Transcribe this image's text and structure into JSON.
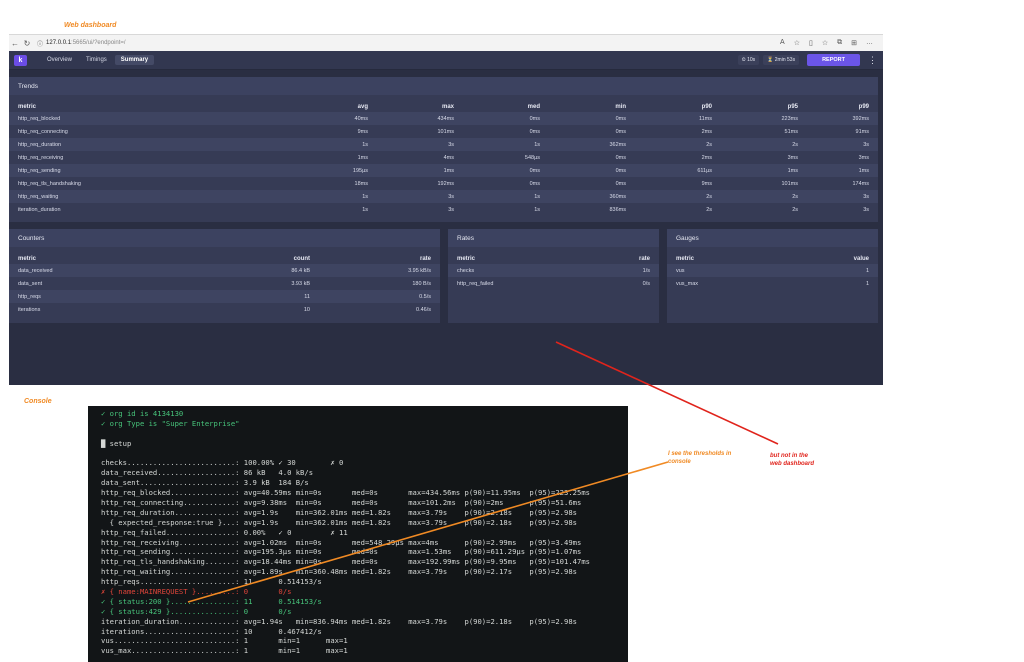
{
  "annotations": {
    "dashboard_title": "Web dashboard",
    "console_title": "Console",
    "note_orange": [
      "I see the thresholds in",
      "console"
    ],
    "note_red": [
      "but not in the",
      "web dashboard"
    ]
  },
  "browser": {
    "url_host": "127.0.0.1",
    "url_path": ":5665/ui/?endpoint=/"
  },
  "app": {
    "logo": "k",
    "tabs": [
      "Overview",
      "Timings",
      "Summary"
    ],
    "active_tab": "Summary",
    "interval_pill": "10s",
    "duration_pill": "2min 53s",
    "report_label": "REPORT",
    "accent_color": "#6b55e8"
  },
  "trends": {
    "title": "Trends",
    "columns": [
      "metric",
      "avg",
      "max",
      "med",
      "min",
      "p90",
      "p95",
      "p99"
    ],
    "rows": [
      [
        "http_req_blocked",
        "40ms",
        "434ms",
        "0ms",
        "0ms",
        "11ms",
        "223ms",
        "392ms"
      ],
      [
        "http_req_connecting",
        "9ms",
        "101ms",
        "0ms",
        "0ms",
        "2ms",
        "51ms",
        "91ms"
      ],
      [
        "http_req_duration",
        "1s",
        "3s",
        "1s",
        "362ms",
        "2s",
        "2s",
        "3s"
      ],
      [
        "http_req_receiving",
        "1ms",
        "4ms",
        "548µs",
        "0ms",
        "2ms",
        "3ms",
        "3ms"
      ],
      [
        "http_req_sending",
        "195µs",
        "1ms",
        "0ms",
        "0ms",
        "611µs",
        "1ms",
        "1ms"
      ],
      [
        "http_req_tls_handshaking",
        "18ms",
        "192ms",
        "0ms",
        "0ms",
        "9ms",
        "101ms",
        "174ms"
      ],
      [
        "http_req_waiting",
        "1s",
        "3s",
        "1s",
        "360ms",
        "2s",
        "2s",
        "3s"
      ],
      [
        "iteration_duration",
        "1s",
        "3s",
        "1s",
        "836ms",
        "2s",
        "2s",
        "3s"
      ]
    ]
  },
  "counters": {
    "title": "Counters",
    "columns": [
      "metric",
      "count",
      "rate"
    ],
    "rows": [
      [
        "data_received",
        "86.4 kB",
        "3.95 kB/s"
      ],
      [
        "data_sent",
        "3.93 kB",
        "180 B/s"
      ],
      [
        "http_reqs",
        "11",
        "0.5/s"
      ],
      [
        "iterations",
        "10",
        "0.46/s"
      ]
    ]
  },
  "rates": {
    "title": "Rates",
    "columns": [
      "metric",
      "rate"
    ],
    "rows": [
      [
        "checks",
        "1/s"
      ],
      [
        "http_req_failed",
        "0/s"
      ]
    ]
  },
  "gauges": {
    "title": "Gauges",
    "columns": [
      "metric",
      "value"
    ],
    "rows": [
      [
        "vus",
        "1"
      ],
      [
        "vus_max",
        "1"
      ]
    ]
  },
  "console": {
    "lines": [
      "✓ org id is 4134130",
      "✓ org Type is \"Super Enterprise\"",
      "",
      "█ setup",
      "",
      "checks.........................: 100.00% ✓ 30        ✗ 0",
      "data_received..................: 86 kB   4.0 kB/s",
      "data_sent......................: 3.9 kB  184 B/s",
      "http_req_blocked...............: avg=40.59ms min=0s       med=0s       max=434.56ms p(90)=11.95ms  p(95)=223.25ms",
      "http_req_connecting............: avg=9.38ms  min=0s       med=0s       max=101.2ms  p(90)=2ms      p(95)=51.6ms",
      "http_req_duration..............: avg=1.9s    min=362.01ms med=1.82s    max=3.79s    p(90)=2.18s    p(95)=2.98s",
      "  { expected_response:true }...: avg=1.9s    min=362.01ms med=1.82s    max=3.79s    p(90)=2.18s    p(95)=2.98s",
      "http_req_failed................: 0.00%   ✓ 0         ✗ 11",
      "http_req_receiving.............: avg=1.02ms  min=0s       med=548.29µs max=4ms      p(90)=2.99ms   p(95)=3.49ms",
      "http_req_sending...............: avg=195.3µs min=0s       med=0s       max=1.53ms   p(90)=611.29µs p(95)=1.07ms",
      "http_req_tls_handshaking.......: avg=18.44ms min=0s       med=0s       max=192.99ms p(90)=9.95ms   p(95)=101.47ms",
      "http_req_waiting...............: avg=1.89s   min=360.48ms med=1.82s    max=3.79s    p(90)=2.17s    p(95)=2.98s",
      "http_reqs......................: 11      0.514153/s",
      "✗ { name:MAINREQUEST }.........: 0       0/s",
      "✓ { status:200 }...............: 11      0.514153/s",
      "✓ { status:429 }...............: 0       0/s",
      "iteration_duration.............: avg=1.94s   min=836.94ms med=1.82s    max=3.79s    p(90)=2.18s    p(95)=2.98s",
      "iterations.....................: 10      0.467412/s",
      "vus............................: 1       min=1      max=1",
      "vus_max........................: 1       min=1      max=1"
    ]
  },
  "colors": {
    "annotation_orange": "#f08a24",
    "annotation_red": "#e0241c",
    "console_green": "#47c47b",
    "console_red": "#e0453a"
  }
}
